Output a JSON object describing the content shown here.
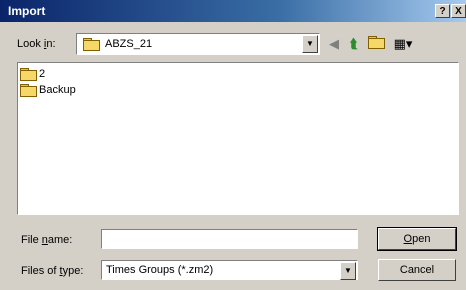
{
  "window": {
    "title": "Import",
    "help_label": "?",
    "close_label": "X"
  },
  "lookin": {
    "label_pre": "Look ",
    "label_u": "i",
    "label_post": "n:",
    "value": "ABZS_21"
  },
  "toolbar": {
    "back_icon": "back-arrow-icon",
    "up_icon": "up-folder-icon",
    "new_folder_icon": "new-folder-icon",
    "views_icon": "view-menu-icon"
  },
  "file_list": {
    "items": [
      {
        "label": "2",
        "icon": "folder-icon"
      },
      {
        "label": "Backup",
        "icon": "folder-icon"
      }
    ]
  },
  "filename": {
    "label_pre": "File ",
    "label_u": "n",
    "label_post": "ame:",
    "value": ""
  },
  "filetype": {
    "label_pre": "Files of ",
    "label_u": "t",
    "label_post": "ype:",
    "value": "Times Groups (*.zm2)"
  },
  "buttons": {
    "open_u": "O",
    "open_rest": "pen",
    "cancel": "Cancel"
  }
}
